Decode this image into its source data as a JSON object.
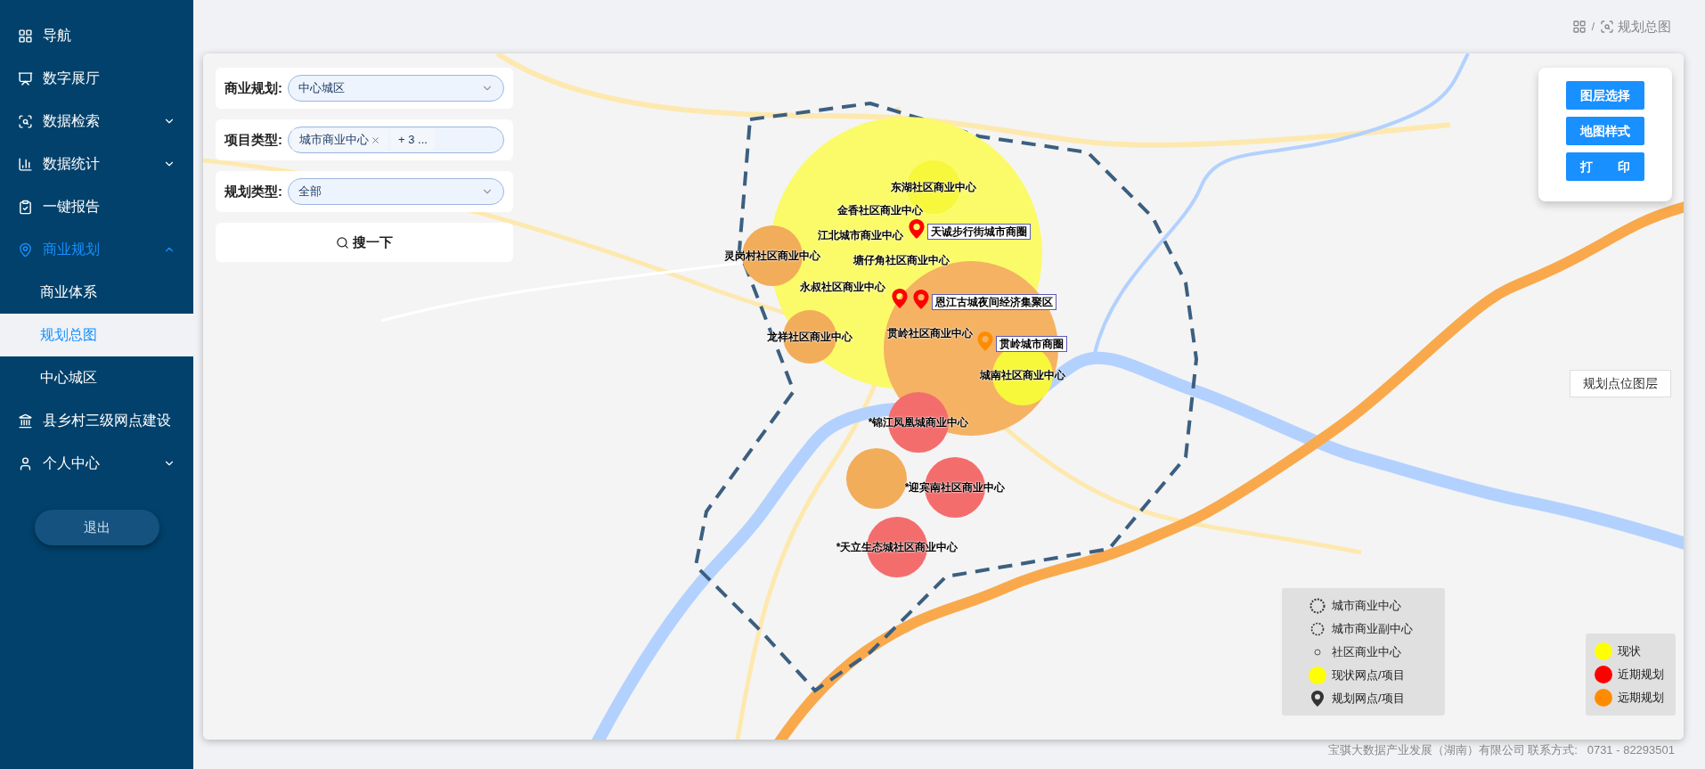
{
  "sidebar": {
    "items": [
      {
        "label": "导航",
        "selected": false
      },
      {
        "label": "数字展厅",
        "selected": false
      },
      {
        "label": "数据检索",
        "selected": false,
        "expanded": false
      },
      {
        "label": "数据统计",
        "selected": false,
        "expanded": false
      },
      {
        "label": "一键报告",
        "selected": false
      },
      {
        "label": "商业规划",
        "selected": true,
        "expanded": true,
        "children": [
          {
            "label": "商业体系",
            "selected": false
          },
          {
            "label": "规划总图",
            "selected": true
          },
          {
            "label": "中心城区",
            "selected": false
          }
        ]
      },
      {
        "label": "县乡村三级网点建设",
        "selected": false
      },
      {
        "label": "个人中心",
        "selected": false,
        "expanded": false
      }
    ],
    "logout_button": "退出"
  },
  "breadcrumb": {
    "separator": "/",
    "items": [
      "规划总图"
    ]
  },
  "filters": [
    {
      "kind": "select",
      "label": "商业规划:",
      "value": "中心城区"
    },
    {
      "kind": "tags",
      "label": "项目类型:",
      "tags": [
        "城市商业中心"
      ],
      "more": "+ 3 ..."
    },
    {
      "kind": "select",
      "label": "规划类型:",
      "value": "全部"
    }
  ],
  "search_button": "搜一下",
  "layer_buttons": [
    "图层选择",
    "地图样式",
    "打　　印"
  ],
  "layer_toggle_button": "规划点位图层",
  "map": {
    "areas": [
      {
        "color": "#fbfb6a"
      },
      {
        "color": "#f5b263"
      },
      {
        "color": "#f7f73c",
        "label": "东湖社区商业中心"
      },
      {
        "color": "#f7f73c",
        "label": "城南社区商业中心"
      },
      {
        "color": "#f2ad5a",
        "label": "灵岗村社区商业中心"
      },
      {
        "color": "#f2ad5a",
        "label": "龙祥社区商业中心"
      },
      {
        "color": "#f2ad5a"
      },
      {
        "color": "#f46d6d",
        "label": "*锦江凤凰城商业中心"
      },
      {
        "color": "#f46d6d",
        "label": "*迎宾南社区商业中心"
      },
      {
        "color": "#f46d6d",
        "label": "*天立生态城社区商业中心"
      }
    ],
    "labels": [
      "金香社区商业中心",
      "江北城市商业中心",
      "塘仔角社区商业中心",
      "永叔社区商业中心",
      "贯岭社区商业中心"
    ],
    "markers": [
      {
        "color": "#ff0000",
        "label": "天诚步行街城市商圈"
      },
      {
        "color": "#ff0000"
      },
      {
        "color": "#ff0000",
        "label": "恩江古城夜间经济集聚区"
      },
      {
        "color": "#ff8c00",
        "label": "贯岭城市商圈"
      }
    ]
  },
  "legend_types": [
    {
      "kind": "city_center",
      "label": "城市商业中心"
    },
    {
      "kind": "sub_center",
      "label": "城市商业副中心"
    },
    {
      "kind": "community",
      "label": "社区商业中心"
    },
    {
      "kind": "current_point",
      "label": "现状网点/项目"
    },
    {
      "kind": "planned_point",
      "label": "规划网点/项目"
    }
  ],
  "legend_status": [
    {
      "label": "现状",
      "color": "#ffff00"
    },
    {
      "label": "近期规划",
      "color": "#ff0000"
    },
    {
      "label": "远期规划",
      "color": "#ff8c00"
    }
  ],
  "footer": "宝骐大数据产业发展（湖南）有限公司 联系方式:   0731 - 82293501"
}
